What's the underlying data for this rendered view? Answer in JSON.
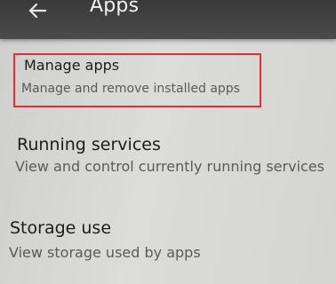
{
  "app_bar": {
    "title": "Apps",
    "back_icon": "arrow-back-icon"
  },
  "items": [
    {
      "title": "Manage apps",
      "summary": "Manage and remove installed apps",
      "highlighted": true
    },
    {
      "title": "Running services",
      "summary": "View and control currently running services",
      "highlighted": false
    },
    {
      "title": "Storage use",
      "summary": "View storage used by apps",
      "highlighted": false
    }
  ],
  "colors": {
    "app_bar": "#424242",
    "title_text": "#1c1c1c",
    "summary_text": "#5a5a5a",
    "highlight_box": "#e03030"
  }
}
